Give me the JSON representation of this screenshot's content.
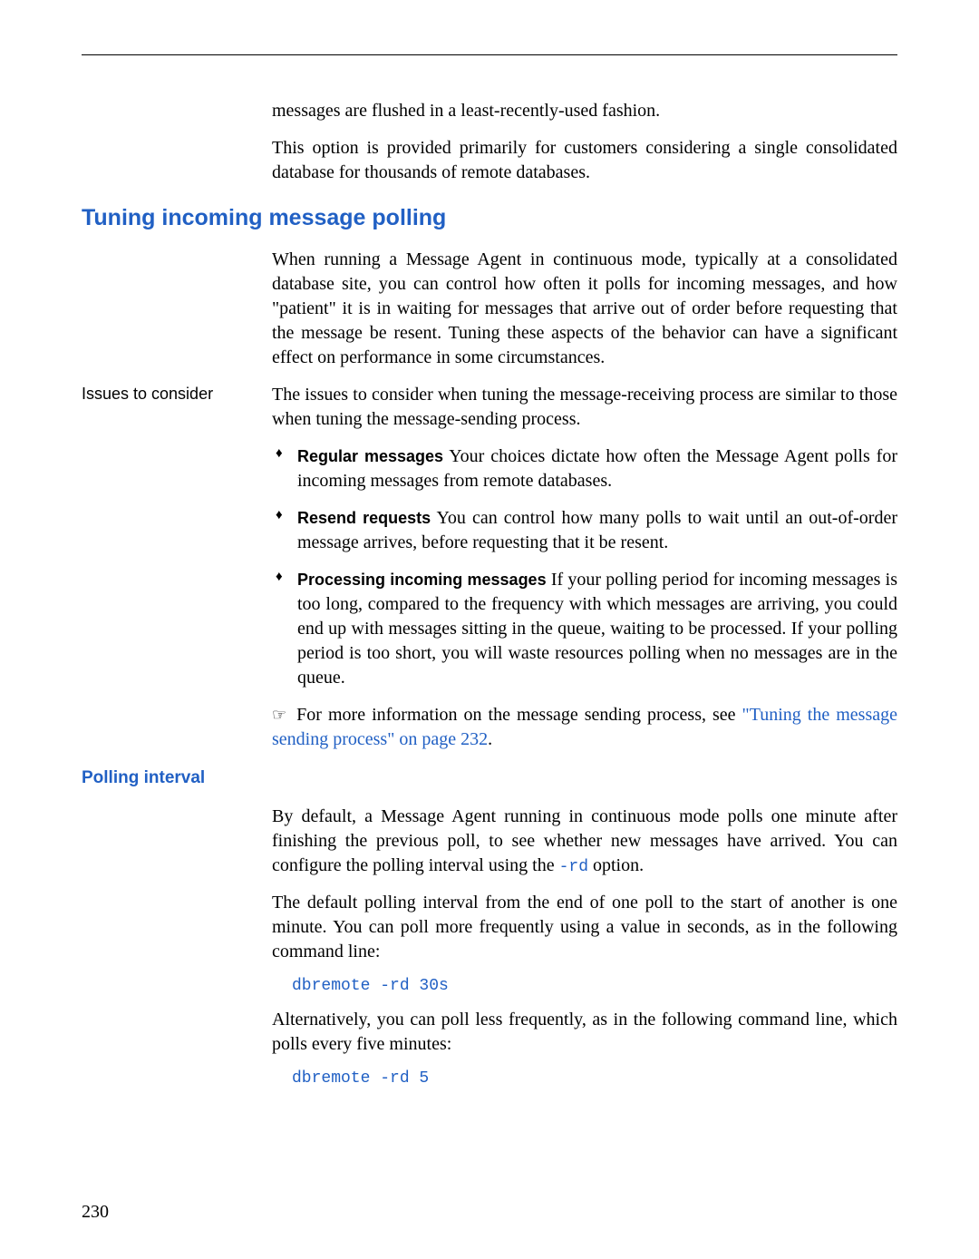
{
  "intro": {
    "p1": "messages are flushed in a least-recently-used fashion.",
    "p2": "This option is provided primarily for customers considering a single consolidated database for thousands of remote databases."
  },
  "section1": {
    "heading": "Tuning incoming message polling",
    "p1": "When running a Message Agent in continuous mode, typically at a consolidated database site, you can control how often it polls for incoming messages, and how \"patient\" it is in waiting for messages that arrive out of order before requesting that the message be resent. Tuning these aspects of the behavior can have a significant effect on performance in some circumstances.",
    "sidebar": "Issues to consider",
    "p2": "The issues to consider when tuning the message-receiving process are similar to those when tuning the message-sending process.",
    "bullets": [
      {
        "label": "Regular messages",
        "text": "   Your choices dictate how often the Message Agent polls for incoming messages from remote databases."
      },
      {
        "label": "Resend requests",
        "text": "   You can control how many polls to wait until an out-of-order message arrives, before requesting that it be resent."
      },
      {
        "label": "Processing incoming messages",
        "text": "   If your polling period for incoming messages is too long, compared to the frequency with which messages are arriving, you could end up with messages sitting in the queue, waiting to be processed. If your polling period is too short, you will waste resources polling when no messages are in the queue."
      }
    ],
    "xref_prefix": "For more information on the message sending process, see ",
    "xref_link": "\"Tuning the message sending process\" on page 232",
    "xref_suffix": "."
  },
  "section2": {
    "heading": "Polling interval",
    "p1_a": "By default, a Message Agent running in continuous mode polls one minute after finishing the previous poll, to see whether new messages have arrived. You can configure the polling interval using the ",
    "p1_code": "-rd",
    "p1_b": " option.",
    "p2": "The default polling interval from the end of one poll to the start of another is one minute. You can poll more frequently using a value in seconds, as in the following command line:",
    "code1": "dbremote -rd 30s",
    "p3": "Alternatively, you can poll less frequently, as in the following command line, which polls every five minutes:",
    "code2": "dbremote -rd 5"
  },
  "page_number": "230"
}
